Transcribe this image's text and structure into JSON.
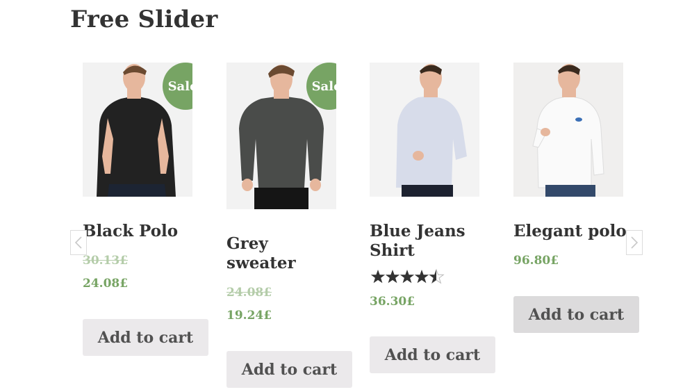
{
  "page": {
    "title": "Free Slider"
  },
  "products": [
    {
      "name_lines": [
        "Black Polo"
      ],
      "old_price": "30.13£",
      "price": "24.08£",
      "sale_badge": "Sale!",
      "button": "Add to cart",
      "shirt_color": "#222222"
    },
    {
      "name_lines": [
        "Grey",
        "sweater"
      ],
      "old_price": "24.08£",
      "price": "19.24£",
      "sale_badge": "Sale!",
      "button": "Add to cart",
      "shirt_color": "#4a4c4a"
    },
    {
      "name_lines": [
        "Blue Jeans",
        "Shirt"
      ],
      "rating": 4.5,
      "price": "36.30£",
      "button": "Add to cart",
      "shirt_color": "#d7dcea"
    },
    {
      "name_lines": [
        "Elegant polo"
      ],
      "price": "96.80£",
      "button": "Add to cart",
      "shirt_color": "#f7f7f7"
    }
  ],
  "nav": {
    "prev_icon": "chevron-left-icon",
    "next_icon": "chevron-right-icon"
  },
  "colors": {
    "accent": "#77a464",
    "button_bg": "#ebe9eb",
    "text": "#333333"
  }
}
